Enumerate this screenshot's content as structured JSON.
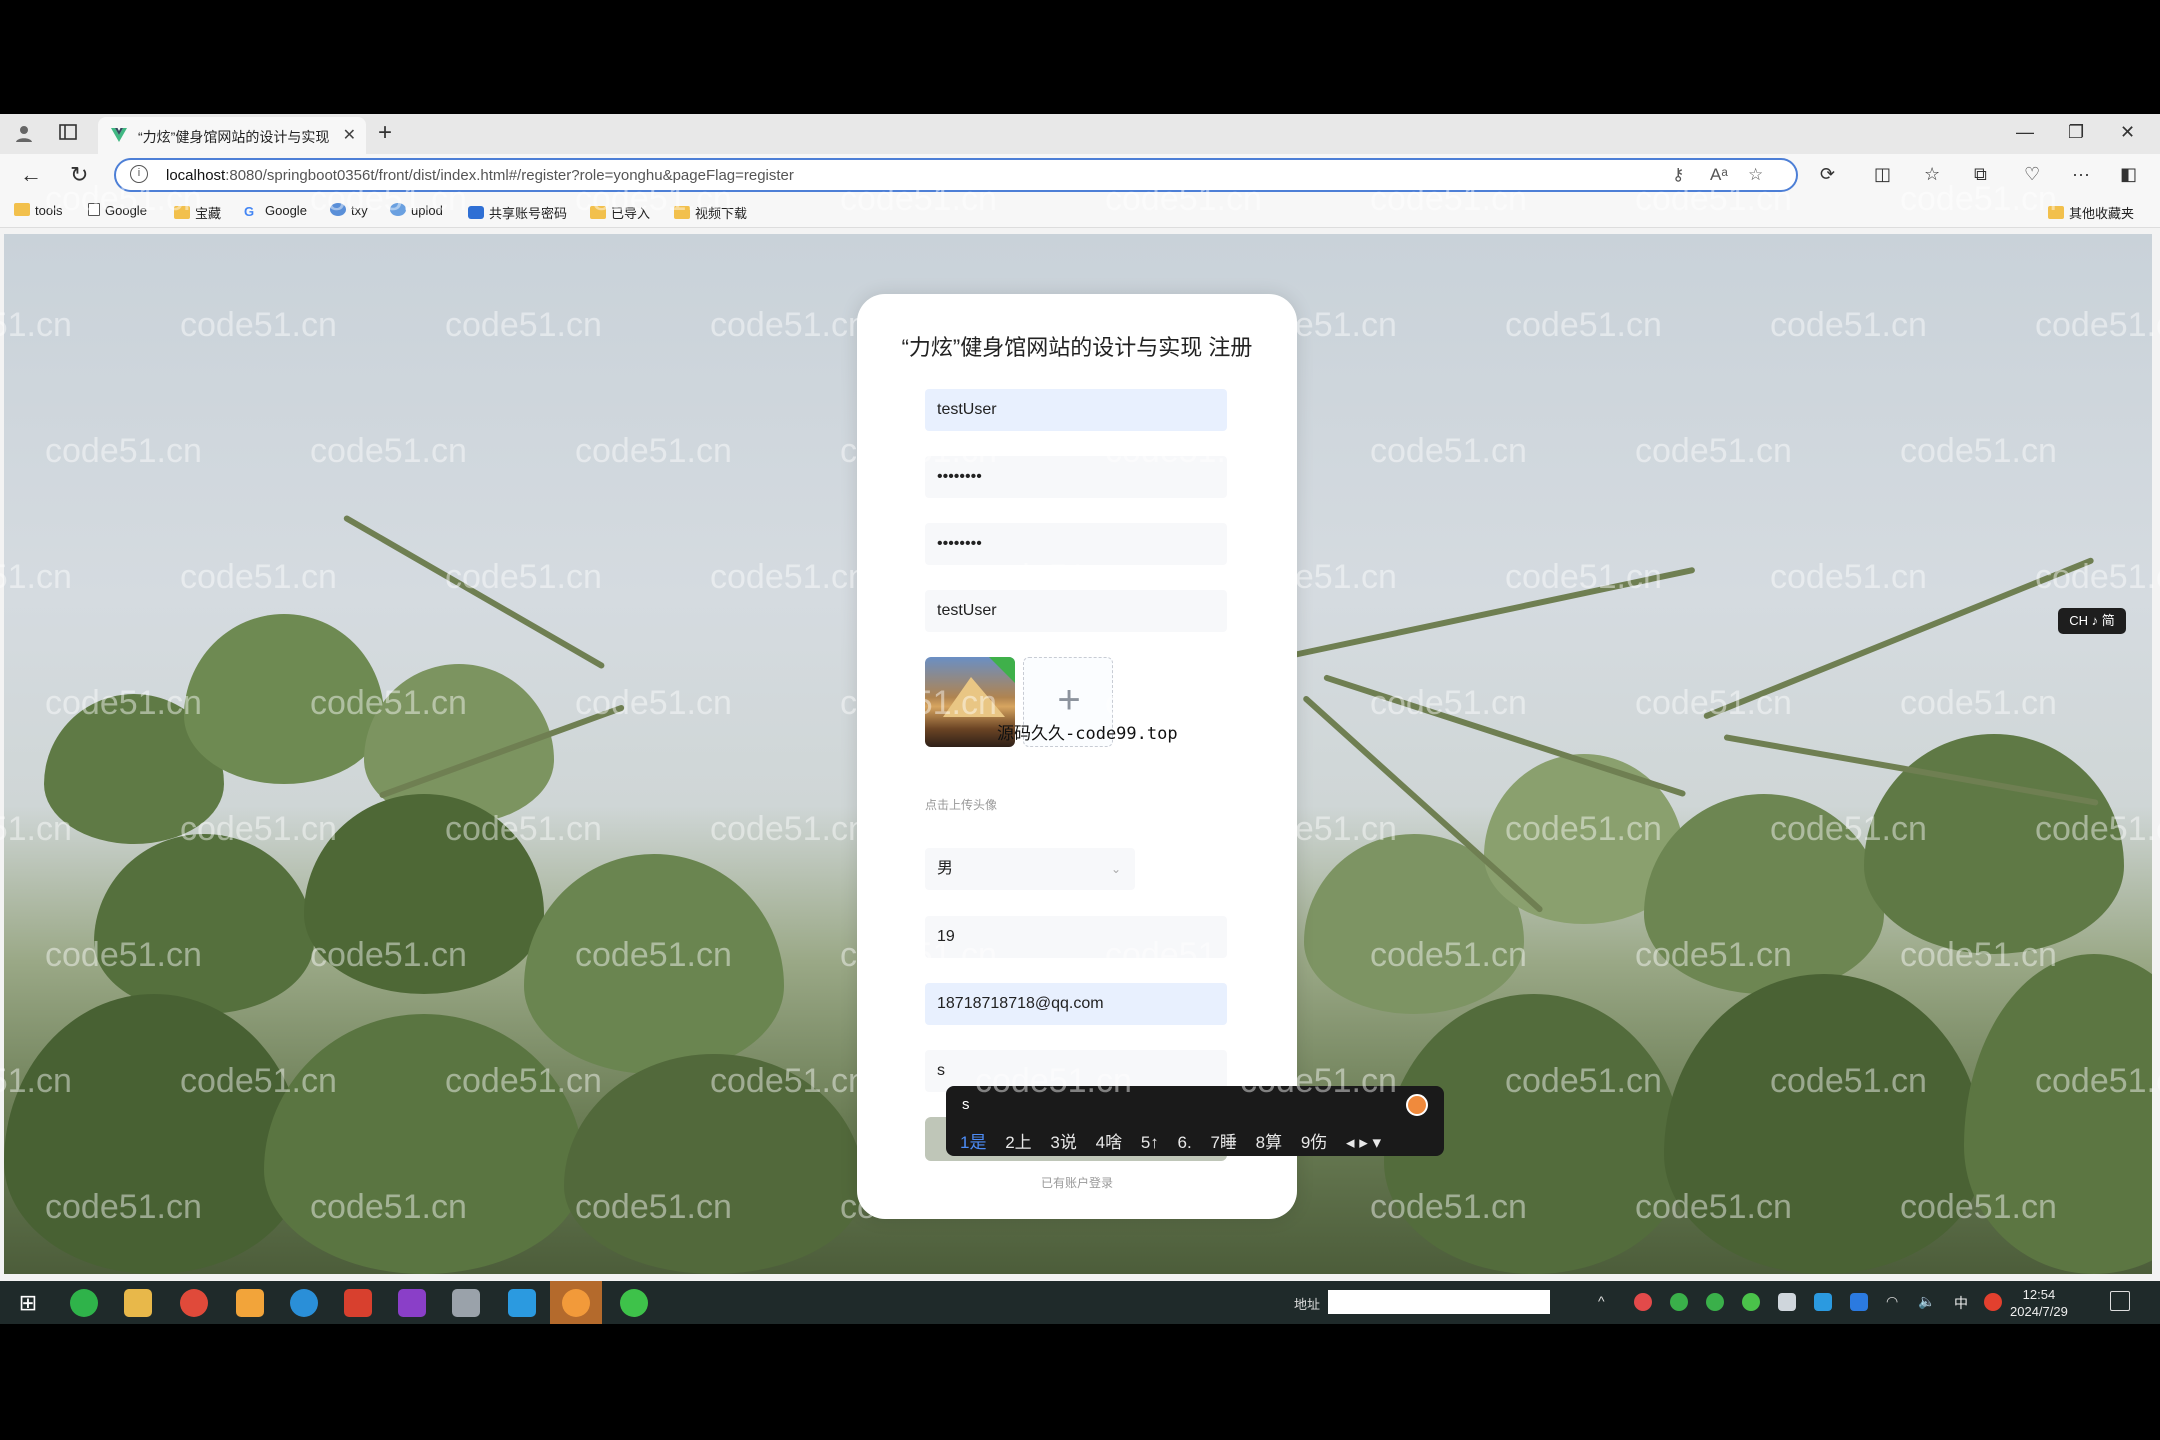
{
  "browser": {
    "tab_title": "“力炫”健身馆网站的设计与实现",
    "tab_close": "✕",
    "new_tab": "+",
    "url_host": "localhost",
    "url_rest": ":8080/springboot0356t/front/dist/index.html#/register?role=yonghu&pageFlag=register",
    "info_glyph": "i",
    "bookmarks": [
      "tools",
      "Google",
      "宝藏",
      "Google",
      "txy",
      "uplod",
      "共享账号密码",
      "已导入",
      "视频下载"
    ],
    "other_bookmarks": "其他收藏夹"
  },
  "register": {
    "title": "“力炫”健身馆网站的设计与实现 注册",
    "username": "testUser",
    "password": "••••••••",
    "confirm_password": "••••••••",
    "name": "testUser",
    "upload_plus": "+",
    "overlay_text": "源码久久-code99.top",
    "avatar_hint": "点击上传头像",
    "gender": "男",
    "gender_chevron": "⌄",
    "age": "19",
    "email": "18718718718@qq.com",
    "phone": "s",
    "login_link": "已有账户登录"
  },
  "ime": {
    "composition": "s",
    "candidates": [
      "1是",
      "2上",
      "3说",
      "4啥",
      "5↑",
      "6.",
      "7睡",
      "8算",
      "9伤"
    ],
    "nav": "◂ ▸ ▾",
    "indicator": "CH ♪ 简"
  },
  "watermark": "code51.cn",
  "taskbar": {
    "address_label": "地址",
    "time": "12:54",
    "date": "2024/7/29",
    "tray_lang": "中"
  }
}
